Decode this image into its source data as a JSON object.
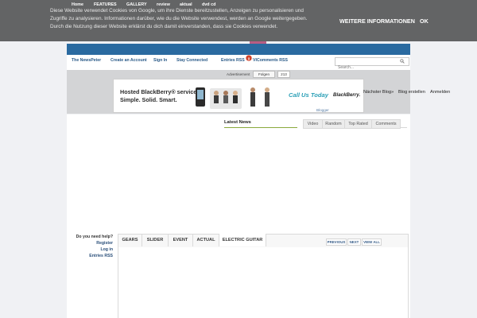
{
  "cookie_bar": {
    "text": "Diese Website verwendet Cookies von Google, um ihre Dienste bereitzustellen, Anzeigen zu personalisieren und Zugriffe zu analysieren. Informationen darüber, wie du die Website verwendest, werden an Google weitergegeben. Durch die Nutzung dieser Website erklärst du dich damit einverstanden, dass sie Cookies verwendet.",
    "more_label": "WEITERE INFORMATIONEN",
    "ok_label": "OK"
  },
  "nav": {
    "items": [
      "Home",
      "FEATURES",
      "GALLERY",
      "review",
      "aktual",
      "dvd cd"
    ]
  },
  "subnav": {
    "items": [
      "The NewsPeter",
      "Create an Account",
      "Sign In",
      "Stay Connected",
      "Entries RSS",
      "Comments RSS"
    ],
    "search_placeholder": "Search..."
  },
  "blogger_bar": {
    "gplus_label": "VI",
    "follow_label": "Folgen",
    "follow_count": "213",
    "next_blog_label": "Nächster Blog»",
    "create_blog_label": "Blog erstellen",
    "sign_in_label": "Anmelden",
    "blogger_fragment": "Blogger"
  },
  "ad": {
    "advertisement_label": "Advertisement",
    "line1": "Hosted BlackBerry® services.",
    "line2": "Simple. Solid. Smart.",
    "cta": "Call Us Today",
    "brand": "BlackBerry."
  },
  "latest_news": {
    "heading": "Latest News",
    "tabs": [
      "Video",
      "Random",
      "Top Rated",
      "Comments"
    ]
  },
  "help": {
    "question": "Do you need help?",
    "links": [
      "Register",
      "Log in",
      "Entries RSS"
    ]
  },
  "gallery": {
    "tabs": [
      "GEARS",
      "SLIDER",
      "EVENT",
      "ACTUAL",
      "ELECTRIC GUITAR"
    ],
    "buttons": [
      "PREVIOUS",
      "NEXT",
      "VIEW ALL"
    ]
  },
  "colors": {
    "nav_bg": "#2a6aa0",
    "cookie_bg": "#636465",
    "accent_green": "#8aa93c",
    "ad_cta": "#2a9fb6"
  }
}
